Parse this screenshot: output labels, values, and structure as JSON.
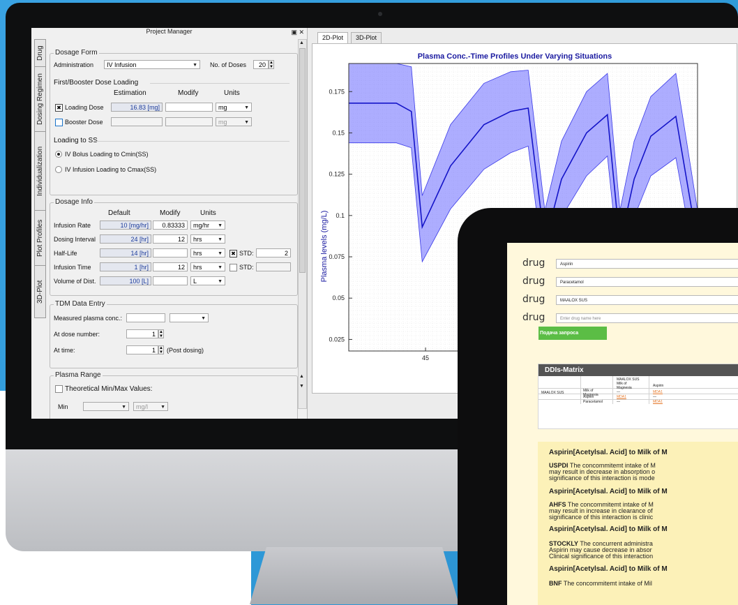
{
  "panel": {
    "title": "Project Manager",
    "float_icons": "▣ ✕"
  },
  "side_tabs": [
    "Drug",
    "Dosing Regimen",
    "Individualization",
    "Plot Profiles",
    "3D-Plot"
  ],
  "dosage_form": {
    "title": "Dosage Form",
    "administration_label": "Administration",
    "administration_value": "IV Infusion",
    "doses_label": "No. of Doses",
    "doses_value": "20"
  },
  "loading": {
    "title": "First/Booster Dose Loading",
    "col_estimation": "Estimation",
    "col_modify": "Modify",
    "col_units": "Units",
    "loading_dose_label": "Loading Dose",
    "loading_dose_est": "16.83 [mg]",
    "loading_dose_unit": "mg",
    "booster_dose_label": "Booster Dose",
    "booster_dose_unit": "mg"
  },
  "loading_ss": {
    "title": "Loading to SS",
    "option1": "IV Bolus Loading to Cmin(SS)",
    "option2": "IV Infusion Loading to Cmax(SS)"
  },
  "dosage_info": {
    "title": "Dosage Info",
    "col_default": "Default",
    "col_modify": "Modify",
    "col_units": "Units",
    "rows": [
      {
        "label": "Infusion Rate",
        "default": "10 [mg/hr]",
        "modify": "0.83333",
        "unit": "mg/hr"
      },
      {
        "label": "Dosing Interval",
        "default": "24 [hr]",
        "modify": "12",
        "unit": "hrs"
      },
      {
        "label": "Half-Life",
        "default": "14 [hr]",
        "modify": "",
        "unit": "hrs"
      },
      {
        "label": "Infusion Time",
        "default": "1 [hr]",
        "modify": "12",
        "unit": "hrs"
      },
      {
        "label": "Volume of Dist.",
        "default": "100 [L]",
        "modify": "",
        "unit": "L"
      }
    ],
    "std_label": "STD:",
    "std1_value": "2",
    "std2_label": "STD:"
  },
  "tdm": {
    "title": "TDM Data Entry",
    "measured_label": "Measured plasma conc.:",
    "dose_number_label": "At dose number:",
    "dose_number_value": "1",
    "time_label": "At time:",
    "time_value": "1",
    "post_label": "(Post dosing)"
  },
  "plasma_range": {
    "title": "Plasma Range",
    "theoretical_label": "Theoretical Min/Max Values:",
    "min_label": "Min",
    "unit": "mg/l"
  },
  "plot_tabs": [
    "2D-Plot",
    "3D-Plot"
  ],
  "chart_data": {
    "type": "area",
    "title": "Plasma Conc.-Time Profiles Under Varying Situations",
    "ylabel": "Plasma levels (mg/L)",
    "xlabel": "",
    "ylim": [
      0.018,
      0.192
    ],
    "xlim": [
      35.8,
      77.6
    ],
    "x_ticks": [
      45
    ],
    "y_ticks": [
      0.025,
      0.05,
      0.075,
      0.1,
      0.125,
      0.15,
      0.175
    ],
    "grid": true,
    "series": [
      {
        "color": "#1414c8",
        "x": [
          35.8,
          39.1,
          41.5,
          43.3,
          44.6,
          48,
          52,
          55.2,
          57.3,
          59.3,
          61.3,
          64.3,
          66.8,
          68.3,
          70,
          72,
          75,
          77.6
        ],
        "values": [
          0.168,
          0.168,
          0.168,
          0.163,
          0.093,
          0.13,
          0.155,
          0.163,
          0.165,
          0.083,
          0.122,
          0.15,
          0.161,
          0.083,
          0.122,
          0.148,
          0.16,
          0.083
        ],
        "upper": [
          0.192,
          0.192,
          0.192,
          0.19,
          0.112,
          0.155,
          0.18,
          0.187,
          0.188,
          0.103,
          0.145,
          0.175,
          0.186,
          0.103,
          0.145,
          0.172,
          0.186,
          0.103
        ],
        "lower": [
          0.144,
          0.144,
          0.144,
          0.141,
          0.072,
          0.104,
          0.128,
          0.138,
          0.142,
          0.063,
          0.099,
          0.124,
          0.136,
          0.063,
          0.099,
          0.124,
          0.135,
          0.063
        ]
      }
    ]
  },
  "tablet": {
    "drug_label": "drug",
    "drugs": [
      "Aspirin",
      "Paracetamol",
      "MAALOX SUS",
      "Enter drug name here"
    ],
    "submit_label": "Подача запроса",
    "matrix_title": "DDIs-Matrix",
    "matrix": {
      "col_maalox": "MAALOX SUS",
      "col_milk": "Milk of Magnesia",
      "col_aspirin": "Aspirin",
      "row_maalox": "MAALOX SUS",
      "row_milk": "Milk of Magnesia",
      "row_aspirin": "Aspirin",
      "row_paracetamol": "Paracetamol",
      "dash": "—",
      "link": "MDA1"
    },
    "articles": [
      {
        "heading": "Aspirin[Acetylsal. Acid] to Milk of M",
        "source": "USPDI",
        "lines": [
          "The concommitemt intake of M",
          "may result in decrease in absorption o",
          "significance of this interaction is mode"
        ]
      },
      {
        "heading": "Aspirin[Acetylsal. Acid] to Milk of M",
        "source": "AHFS",
        "lines": [
          "The concommitemt intake of M",
          "may result in increase in clearance of",
          "significance of this interaction is clinic"
        ]
      },
      {
        "heading": "Aspirin[Acetylsal. Acid] to Milk of M",
        "source": "STOCKLY",
        "lines": [
          "The concurrent administra",
          "Aspirin may cause decrease in absor",
          "Clinical significance of this interaction"
        ]
      },
      {
        "heading": "Aspirin[Acetylsal. Acid] to Milk of M",
        "source": "BNF",
        "lines": [
          "The concommitemt intake of Mil"
        ]
      }
    ]
  }
}
